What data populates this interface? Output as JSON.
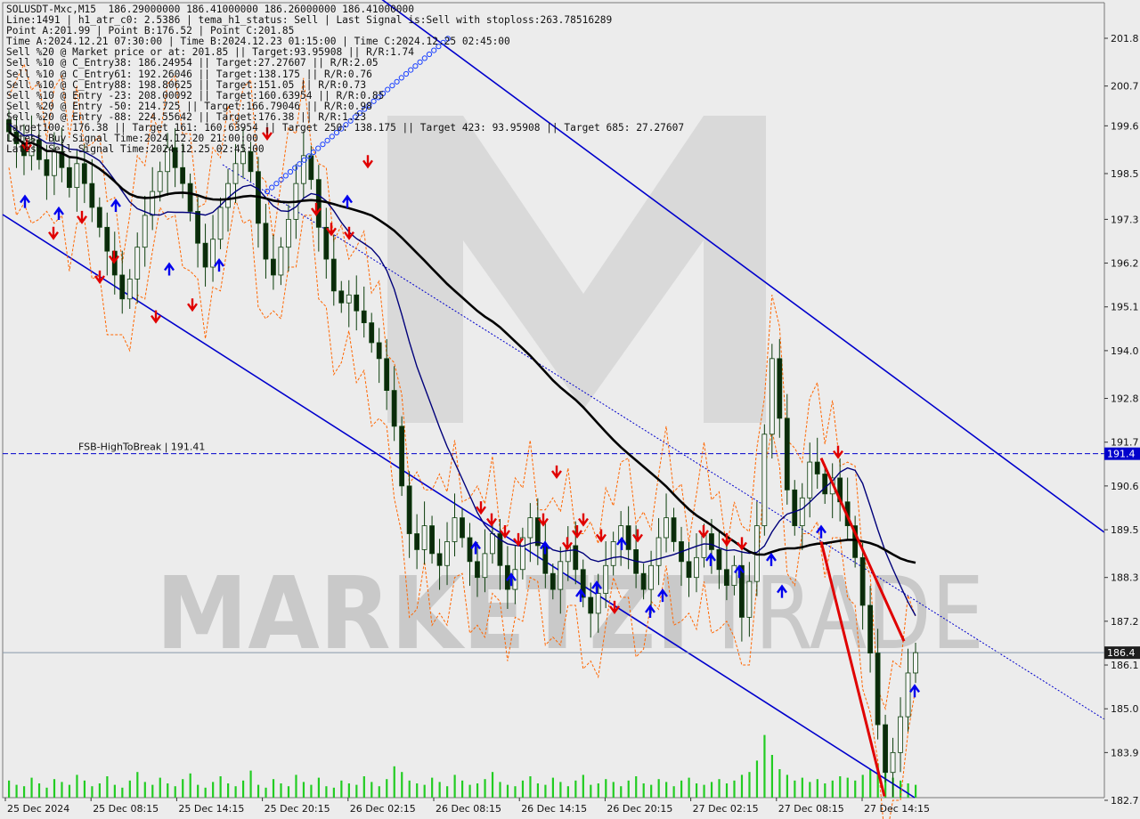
{
  "info_lines": [
    "SOLUSDT-Mxc,M15  186.29000000 186.41000000 186.26000000 186.41000000",
    "Line:1491 | h1_atr_c0: 2.5386 | tema_h1_status: Sell | Last Signal is:Sell with stoploss:263.78516289",
    "Point A:201.99 | Point B:176.52 | Point C:201.85",
    "Time A:2024.12.21 07:30:00 | Time B:2024.12.23 01:15:00 | Time C:2024.12.25 02:45:00",
    "Sell %20 @ Market price or at: 201.85 || Target:93.95908 || R/R:1.74",
    "Sell %10 @ C_Entry38: 186.24954 || Target:27.27607 || R/R:2.05",
    "Sell %10 @ C_Entry61: 192.26046 || Target:138.175 || R/R:0.76",
    "Sell %10 @ C_Entry88: 198.80625 || Target:151.05 || R/R:0.73",
    "Sell %10 @ Entry -23: 208.00092 || Target:160.63954 || R/R:0.85",
    "Sell %20 @ Entry -50: 214.725 || Target:166.79046 || R/R:0.98",
    "Sell %20 @ Entry -88: 224.55642 || Target:176.38 || R/R:1.23",
    "Target100: 176.38 || Target 161: 160.63954 || Target 250: 138.175 || Target 423: 93.95908 || Target 685: 27.27607",
    "Latest Buy Signal Time:2024.12.20 21:00:00",
    "Latest Sell Signal Time:2024.12.25 02:45:00"
  ],
  "watermark": {
    "brand_left": "MARKETZI",
    "brand_right": "TRADE"
  },
  "colors": {
    "background": "#ececec",
    "channel": "#0000cc",
    "ma_fast": "#00007a",
    "ma_slow": "#000000",
    "candle": "#0b3d0b",
    "band": "#ff6600",
    "signal_sell": "#e00000",
    "signal_buy": "#0000ee",
    "volume": "#22cc22",
    "price_tag_bg": "#1e1e1e",
    "level_tag_bg": "#0000cc"
  },
  "chart_data": {
    "type": "candlestick",
    "symbol": "SOLUSDT-Mxc",
    "timeframe": "M15",
    "ohlc": {
      "open": 186.29,
      "high": 186.41,
      "low": 186.26,
      "close": 186.41
    },
    "ylim": [
      182.4,
      202.5
    ],
    "y_ticks": [
      {
        "label": "201.8",
        "value": 201.85
      },
      {
        "label": "200.7",
        "value": 200.65
      },
      {
        "label": "199.6",
        "value": 199.65
      },
      {
        "label": "198.5",
        "value": 198.45
      },
      {
        "label": "197.3",
        "value": 197.3
      },
      {
        "label": "196.2",
        "value": 196.2
      },
      {
        "label": "195.1",
        "value": 195.1
      },
      {
        "label": "194.0",
        "value": 194.0
      },
      {
        "label": "192.8",
        "value": 192.8
      },
      {
        "label": "191.7",
        "value": 191.7
      },
      {
        "label": "190.6",
        "value": 190.6
      },
      {
        "label": "189.5",
        "value": 189.5
      },
      {
        "label": "188.3",
        "value": 188.3
      },
      {
        "label": "187.2",
        "value": 187.2
      },
      {
        "label": "186.1",
        "value": 186.1
      },
      {
        "label": "185.0",
        "value": 185.0
      },
      {
        "label": "183.9",
        "value": 183.9
      },
      {
        "label": "182.7",
        "value": 182.7
      }
    ],
    "x_ticks": [
      "25 Dec 2024",
      "25 Dec 08:15",
      "25 Dec 14:15",
      "25 Dec 20:15",
      "26 Dec 02:15",
      "26 Dec 08:15",
      "26 Dec 14:15",
      "26 Dec 20:15",
      "27 Dec 02:15",
      "27 Dec 08:15",
      "27 Dec 14:15"
    ],
    "levels": [
      {
        "name": "FSB-HighToBreak",
        "label": "FSB-HighToBreak | 191.41",
        "value": 191.41,
        "tag": "191.4"
      },
      {
        "name": "current-price",
        "value": 186.41,
        "tag": "186.4"
      }
    ],
    "closes": [
      199.5,
      199.2,
      198.9,
      199.3,
      198.8,
      198.4,
      199.0,
      198.6,
      198.1,
      198.7,
      198.2,
      197.6,
      197.1,
      196.5,
      195.9,
      195.3,
      195.8,
      196.6,
      197.4,
      198.0,
      198.5,
      199.1,
      198.6,
      198.2,
      197.5,
      196.7,
      196.1,
      196.8,
      197.6,
      198.2,
      198.7,
      199.0,
      198.5,
      197.2,
      196.3,
      195.9,
      196.6,
      197.3,
      198.2,
      198.9,
      198.3,
      197.1,
      196.3,
      195.5,
      195.2,
      195.4,
      195.0,
      194.7,
      194.2,
      193.8,
      193.0,
      192.1,
      190.6,
      189.4,
      189.0,
      189.6,
      188.9,
      188.6,
      189.2,
      189.8,
      189.3,
      188.7,
      188.3,
      188.9,
      189.4,
      188.6,
      188.0,
      188.5,
      189.3,
      189.8,
      189.1,
      188.4,
      188.0,
      188.7,
      189.1,
      188.5,
      187.8,
      187.4,
      187.9,
      188.6,
      189.2,
      189.6,
      189.0,
      188.4,
      188.0,
      188.6,
      189.3,
      189.8,
      189.2,
      188.7,
      188.3,
      188.8,
      189.4,
      189.0,
      188.5,
      188.1,
      188.6,
      187.3,
      188.2,
      189.6,
      191.9,
      193.8,
      192.3,
      190.5,
      189.6,
      190.3,
      191.2,
      190.9,
      190.4,
      190.8,
      190.2,
      189.6,
      188.8,
      187.6,
      186.4,
      184.6,
      183.4,
      183.9,
      184.8,
      185.9,
      186.41
    ],
    "volumes": [
      12,
      9,
      8,
      14,
      10,
      7,
      13,
      11,
      9,
      16,
      12,
      8,
      10,
      15,
      9,
      7,
      12,
      18,
      11,
      9,
      14,
      10,
      8,
      13,
      17,
      9,
      7,
      11,
      15,
      10,
      8,
      12,
      19,
      9,
      7,
      13,
      10,
      8,
      16,
      11,
      9,
      14,
      8,
      7,
      12,
      10,
      9,
      15,
      11,
      8,
      13,
      22,
      18,
      12,
      10,
      9,
      14,
      11,
      8,
      16,
      12,
      9,
      10,
      13,
      18,
      11,
      9,
      8,
      12,
      15,
      10,
      9,
      14,
      11,
      8,
      12,
      16,
      9,
      10,
      13,
      11,
      8,
      12,
      15,
      10,
      9,
      13,
      11,
      8,
      12,
      14,
      10,
      9,
      11,
      13,
      10,
      12,
      16,
      18,
      26,
      44,
      30,
      20,
      16,
      12,
      14,
      11,
      13,
      10,
      12,
      15,
      14,
      12,
      16,
      20,
      24,
      18,
      14,
      12,
      10,
      9
    ],
    "signals": {
      "sell": [
        [
          30,
          199.0
        ],
        [
          60,
          196.8
        ],
        [
          92,
          197.2
        ],
        [
          112,
          195.7
        ],
        [
          128,
          196.2
        ],
        [
          175,
          194.7
        ],
        [
          216,
          195.0
        ],
        [
          300,
          199.3
        ],
        [
          355,
          197.4
        ],
        [
          372,
          196.9
        ],
        [
          392,
          196.8
        ],
        [
          413,
          198.6
        ],
        [
          540,
          189.9
        ],
        [
          552,
          189.6
        ],
        [
          567,
          189.3
        ],
        [
          582,
          189.1
        ],
        [
          610,
          189.6
        ],
        [
          625,
          190.8
        ],
        [
          637,
          189.0
        ],
        [
          648,
          189.3
        ],
        [
          655,
          189.6
        ],
        [
          675,
          189.2
        ],
        [
          690,
          187.4
        ],
        [
          716,
          189.2
        ],
        [
          790,
          189.3
        ],
        [
          816,
          189.1
        ],
        [
          833,
          189.0
        ],
        [
          941,
          191.3
        ]
      ],
      "buy": [
        [
          28,
          197.9
        ],
        [
          66,
          197.6
        ],
        [
          130,
          197.8
        ],
        [
          190,
          196.2
        ],
        [
          246,
          196.3
        ],
        [
          390,
          197.9
        ],
        [
          534,
          189.2
        ],
        [
          574,
          188.4
        ],
        [
          612,
          189.2
        ],
        [
          652,
          188.0
        ],
        [
          670,
          188.2
        ],
        [
          698,
          189.3
        ],
        [
          730,
          187.6
        ],
        [
          744,
          188.0
        ],
        [
          798,
          188.9
        ],
        [
          830,
          188.6
        ],
        [
          866,
          188.9
        ],
        [
          878,
          188.1
        ],
        [
          922,
          189.6
        ],
        [
          1027,
          185.6
        ]
      ]
    }
  }
}
